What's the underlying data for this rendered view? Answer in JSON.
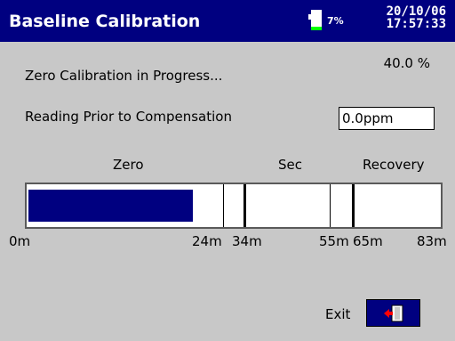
{
  "header": {
    "title": "Baseline Calibration",
    "battery_percent": "7%",
    "date": "20/10/06",
    "time": "17:57:33"
  },
  "status": {
    "message": "Zero Calibration in Progress...",
    "progress_percent": "40.0 %",
    "progress_fraction": 0.4
  },
  "reading": {
    "label": "Reading Prior to Compensation",
    "value": "0.0ppm"
  },
  "timeline": {
    "phases": [
      "Zero",
      "Sec",
      "Recovery"
    ],
    "ticks": [
      "0m",
      "24m",
      "34m",
      "55m",
      "65m",
      "83m"
    ]
  },
  "footer": {
    "exit_label": "Exit",
    "exit_icon": "exit-door-icon"
  },
  "colors": {
    "titlebar": "#000080",
    "background": "#c8c8c8",
    "progress_fill": "#000080",
    "battery_fill": "#00ff00",
    "exit_arrow": "#ff0000"
  }
}
